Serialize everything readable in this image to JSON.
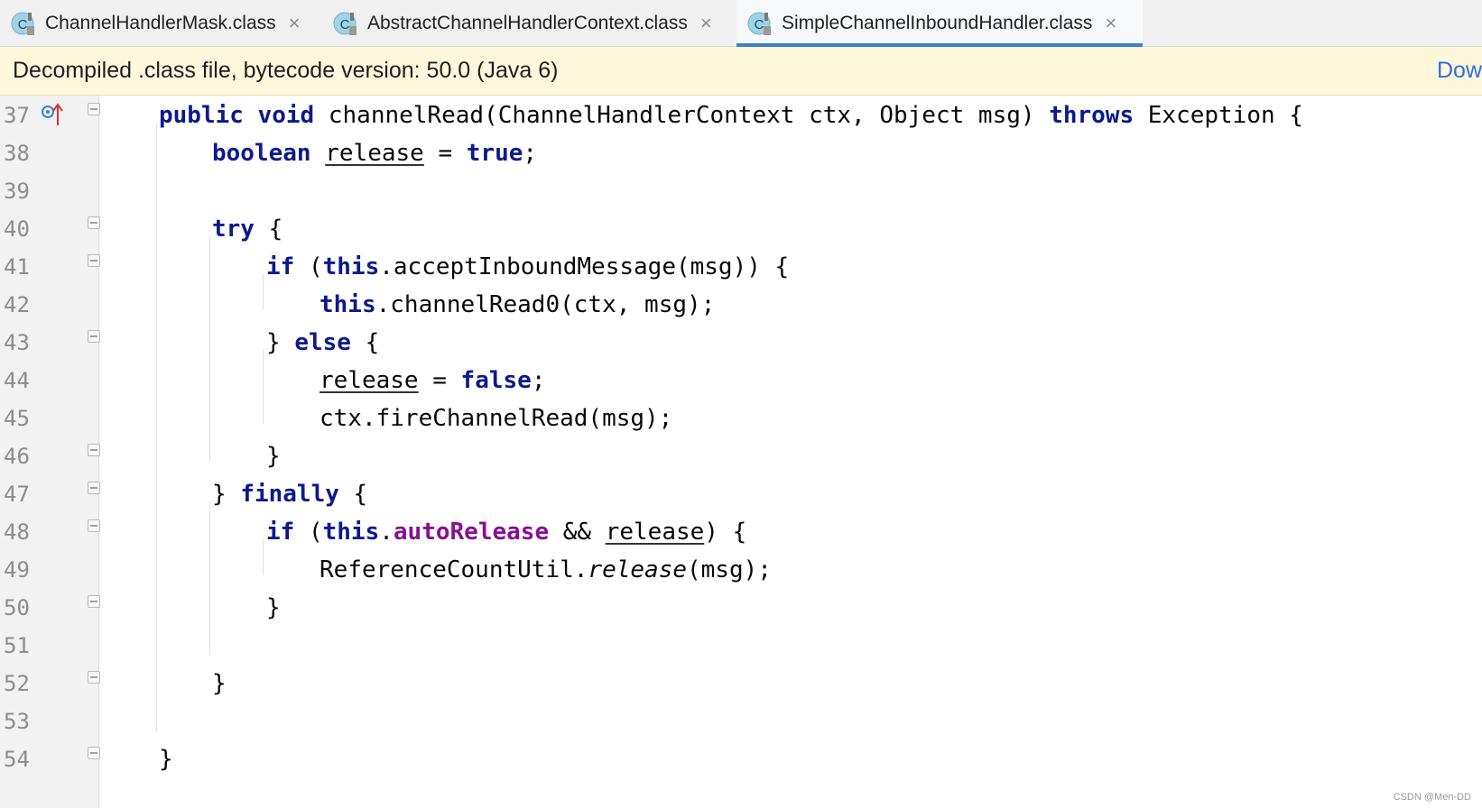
{
  "tabs": [
    {
      "label": "ChannelHandlerMask.class",
      "active": false,
      "icon": "java-class-icon"
    },
    {
      "label": "AbstractChannelHandlerContext.class",
      "active": false,
      "icon": "java-class-icon"
    },
    {
      "label": "SimpleChannelInboundHandler.class",
      "active": true,
      "icon": "java-class-icon"
    }
  ],
  "close_glyph": "×",
  "banner": {
    "text": "Decompiled .class file, bytecode version: 50.0 (Java 6)",
    "link": "Dow"
  },
  "lines": [
    {
      "n": "37"
    },
    {
      "n": "38"
    },
    {
      "n": "39"
    },
    {
      "n": "40"
    },
    {
      "n": "41"
    },
    {
      "n": "42"
    },
    {
      "n": "43"
    },
    {
      "n": "44"
    },
    {
      "n": "45"
    },
    {
      "n": "46"
    },
    {
      "n": "47"
    },
    {
      "n": "48"
    },
    {
      "n": "49"
    },
    {
      "n": "50"
    },
    {
      "n": "51"
    },
    {
      "n": "52"
    },
    {
      "n": "53"
    },
    {
      "n": "54"
    }
  ],
  "code": {
    "l37": {
      "a": "public",
      "b": "void",
      "c": " channelRead(ChannelHandlerContext ctx, Object msg) ",
      "d": "throws",
      "e": " Exception {"
    },
    "l38": {
      "a": "boolean",
      "b": "release",
      "c": " = ",
      "d": "true",
      "e": ";"
    },
    "l40": {
      "a": "try",
      "b": " {"
    },
    "l41": {
      "a": "if",
      "b": " (",
      "c": "this",
      "d": ".acceptInboundMessage(msg)) {"
    },
    "l42": {
      "a": "this",
      "b": ".channelRead0(ctx, msg);"
    },
    "l43": {
      "a": "} ",
      "b": "else",
      "c": " {"
    },
    "l44": {
      "a": "release",
      "b": " = ",
      "c": "false",
      "d": ";"
    },
    "l45": {
      "a": "ctx.fireChannelRead(msg);"
    },
    "l46": {
      "a": "}"
    },
    "l47": {
      "a": "} ",
      "b": "finally",
      "c": " {"
    },
    "l48": {
      "a": "if",
      "b": " (",
      "c": "this",
      "d": ".",
      "e": "autoRelease",
      "f": " && ",
      "g": "release",
      "h": ") {"
    },
    "l49": {
      "a": "ReferenceCountUtil.",
      "b": "release",
      "c": "(msg);"
    },
    "l50": {
      "a": "}"
    },
    "l52": {
      "a": "}"
    },
    "l54": {
      "a": "}"
    }
  },
  "watermark": "CSDN @Men-DD",
  "colors": {
    "keyword": "#0b1a8c",
    "field": "#871094",
    "active_tab_underline": "#3b7fd4",
    "banner_bg": "#fdf8dc",
    "banner_link": "#2f6fd6"
  }
}
